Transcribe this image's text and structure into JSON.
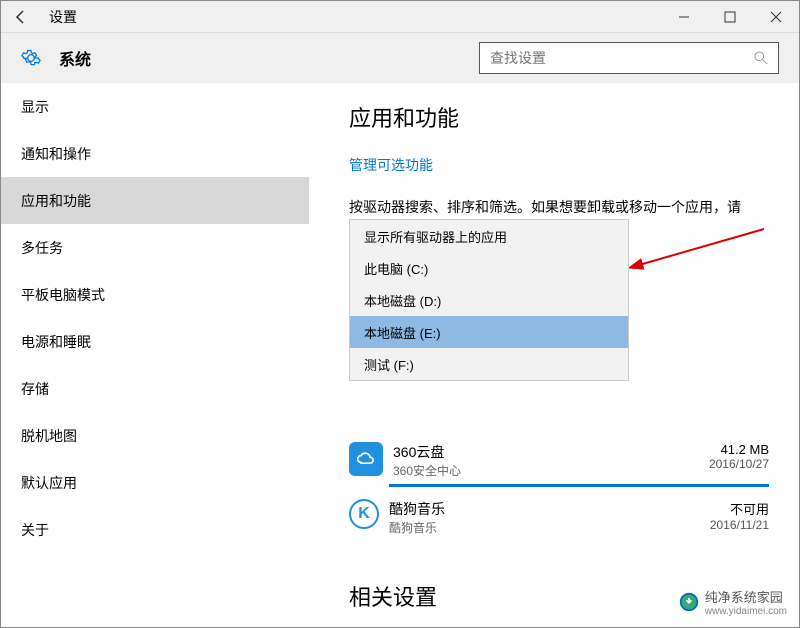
{
  "window": {
    "title": "设置"
  },
  "header": {
    "label": "系统",
    "search_placeholder": "查找设置"
  },
  "sidebar": {
    "items": [
      {
        "label": "显示"
      },
      {
        "label": "通知和操作"
      },
      {
        "label": "应用和功能"
      },
      {
        "label": "多任务"
      },
      {
        "label": "平板电脑模式"
      },
      {
        "label": "电源和睡眠"
      },
      {
        "label": "存储"
      },
      {
        "label": "脱机地图"
      },
      {
        "label": "默认应用"
      },
      {
        "label": "关于"
      }
    ],
    "selected_index": 2
  },
  "main": {
    "heading": "应用和功能",
    "link": "管理可选功能",
    "desc": "按驱动器搜索、排序和筛选。如果想要卸载或移动一个应用，请",
    "dropdown": {
      "items": [
        "显示所有驱动器上的应用",
        "此电脑 (C:)",
        "本地磁盘 (D:)",
        "本地磁盘 (E:)",
        "测试 (F:)"
      ],
      "highlighted_index": 3
    },
    "apps": [
      {
        "name": "360云盘",
        "publisher": "360安全中心",
        "size": "41.2 MB",
        "date": "2016/10/27",
        "icon": "cloud"
      },
      {
        "name": "酷狗音乐",
        "publisher": "酷狗音乐",
        "size": "不可用",
        "date": "2016/11/21",
        "icon": "kugou"
      }
    ],
    "related_heading": "相关设置"
  },
  "watermark": {
    "brand": "纯净系统家园",
    "url": "www.yidaimei.com"
  }
}
